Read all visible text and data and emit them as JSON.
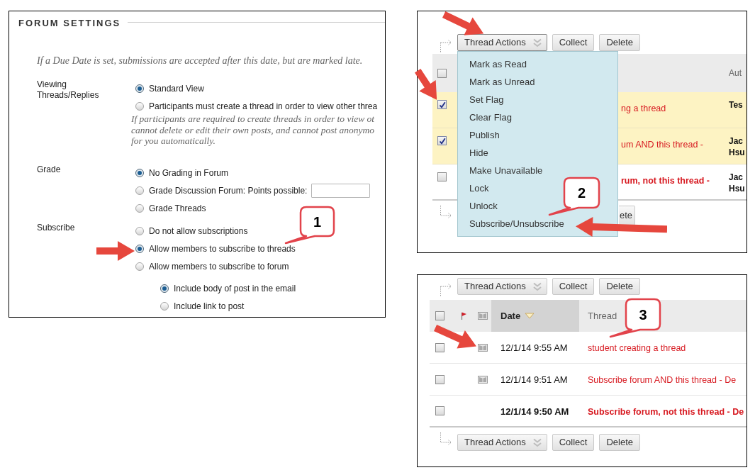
{
  "forum_settings": {
    "title": "FORUM SETTINGS",
    "note": "If a Due Date is set, submissions are accepted after this date, but are marked late.",
    "groups": [
      {
        "label": "Viewing Threads/Replies",
        "options": [
          {
            "label": "Standard View",
            "selected": true
          },
          {
            "label": "Participants must create a thread in order to view other threa",
            "selected": false
          }
        ],
        "hint_lines": [
          "If participants are required to create threads in order to view ot",
          "cannot delete or edit their own posts, and cannot post anonymo",
          "for you automatically."
        ]
      },
      {
        "label": "Grade",
        "options": [
          {
            "kind": "radio",
            "label": "No Grading in Forum",
            "selected": true
          },
          {
            "kind": "radio_input",
            "label": "Grade Discussion Forum: Points possible:",
            "selected": false
          },
          {
            "kind": "radio",
            "label": "Grade Threads",
            "selected": false
          }
        ]
      },
      {
        "label": "Subscribe",
        "options": [
          {
            "label": "Do not allow subscriptions",
            "selected": false
          },
          {
            "label": "Allow members to subscribe to threads",
            "selected": true
          },
          {
            "label": "Allow members to subscribe to forum",
            "selected": false,
            "children": [
              {
                "label": "Include body of post in the email",
                "selected": true
              },
              {
                "label": "Include link to post",
                "selected": false
              }
            ]
          }
        ]
      }
    ],
    "callout": "1"
  },
  "thread_list_menu_open": {
    "top_toolbar": [
      {
        "kind": "dropdown",
        "label": "Thread Actions",
        "expanded": true
      },
      {
        "kind": "button",
        "label": "Collect"
      },
      {
        "kind": "button",
        "label": "Delete"
      }
    ],
    "menu": [
      "Mark as Read",
      "Mark as Unread",
      "Set Flag",
      "Clear Flag",
      "Publish",
      "Hide",
      "Make Unavailable",
      "Lock",
      "Unlock",
      "Subscribe/Unsubscribe"
    ],
    "select_all_checked": false,
    "column_heading": "Aut",
    "rows": [
      {
        "checked": true,
        "read": true,
        "thread": "ng a thread",
        "author_lines": [
          "Tes"
        ]
      },
      {
        "checked": true,
        "read": true,
        "thread": "um AND this thread -",
        "author_lines": [
          "Jac",
          "Hsu"
        ]
      },
      {
        "checked": false,
        "read": false,
        "thread": "rum, not this thread -",
        "author_lines": [
          "Jac",
          "Hsu"
        ]
      }
    ],
    "bottom_toolbar": [
      {
        "kind": "button",
        "label": "ete"
      }
    ],
    "callout": "2"
  },
  "thread_list": {
    "top_toolbar": [
      {
        "kind": "dropdown",
        "label": "Thread Actions",
        "expanded": false
      },
      {
        "kind": "button",
        "label": "Collect"
      },
      {
        "kind": "button",
        "label": "Delete"
      }
    ],
    "select_all_checked": false,
    "columns": [
      {
        "label": "Date",
        "sorted": true
      },
      {
        "label": "Thread",
        "sorted": false
      }
    ],
    "rows": [
      {
        "checked": false,
        "read": true,
        "date": "12/1/14 9:55 AM",
        "thread": "student creating a thread"
      },
      {
        "checked": false,
        "read": true,
        "date": "12/1/14 9:51 AM",
        "thread": "Subscribe forum AND this thread - De"
      },
      {
        "checked": false,
        "read": false,
        "date": "12/1/14 9:50 AM",
        "thread": "Subscribe forum, not this thread - De"
      }
    ],
    "bottom_toolbar": [
      {
        "kind": "dropdown",
        "label": "Thread Actions",
        "expanded": false
      },
      {
        "kind": "button",
        "label": "Collect"
      },
      {
        "kind": "button",
        "label": "Delete"
      }
    ],
    "callout": "3"
  }
}
